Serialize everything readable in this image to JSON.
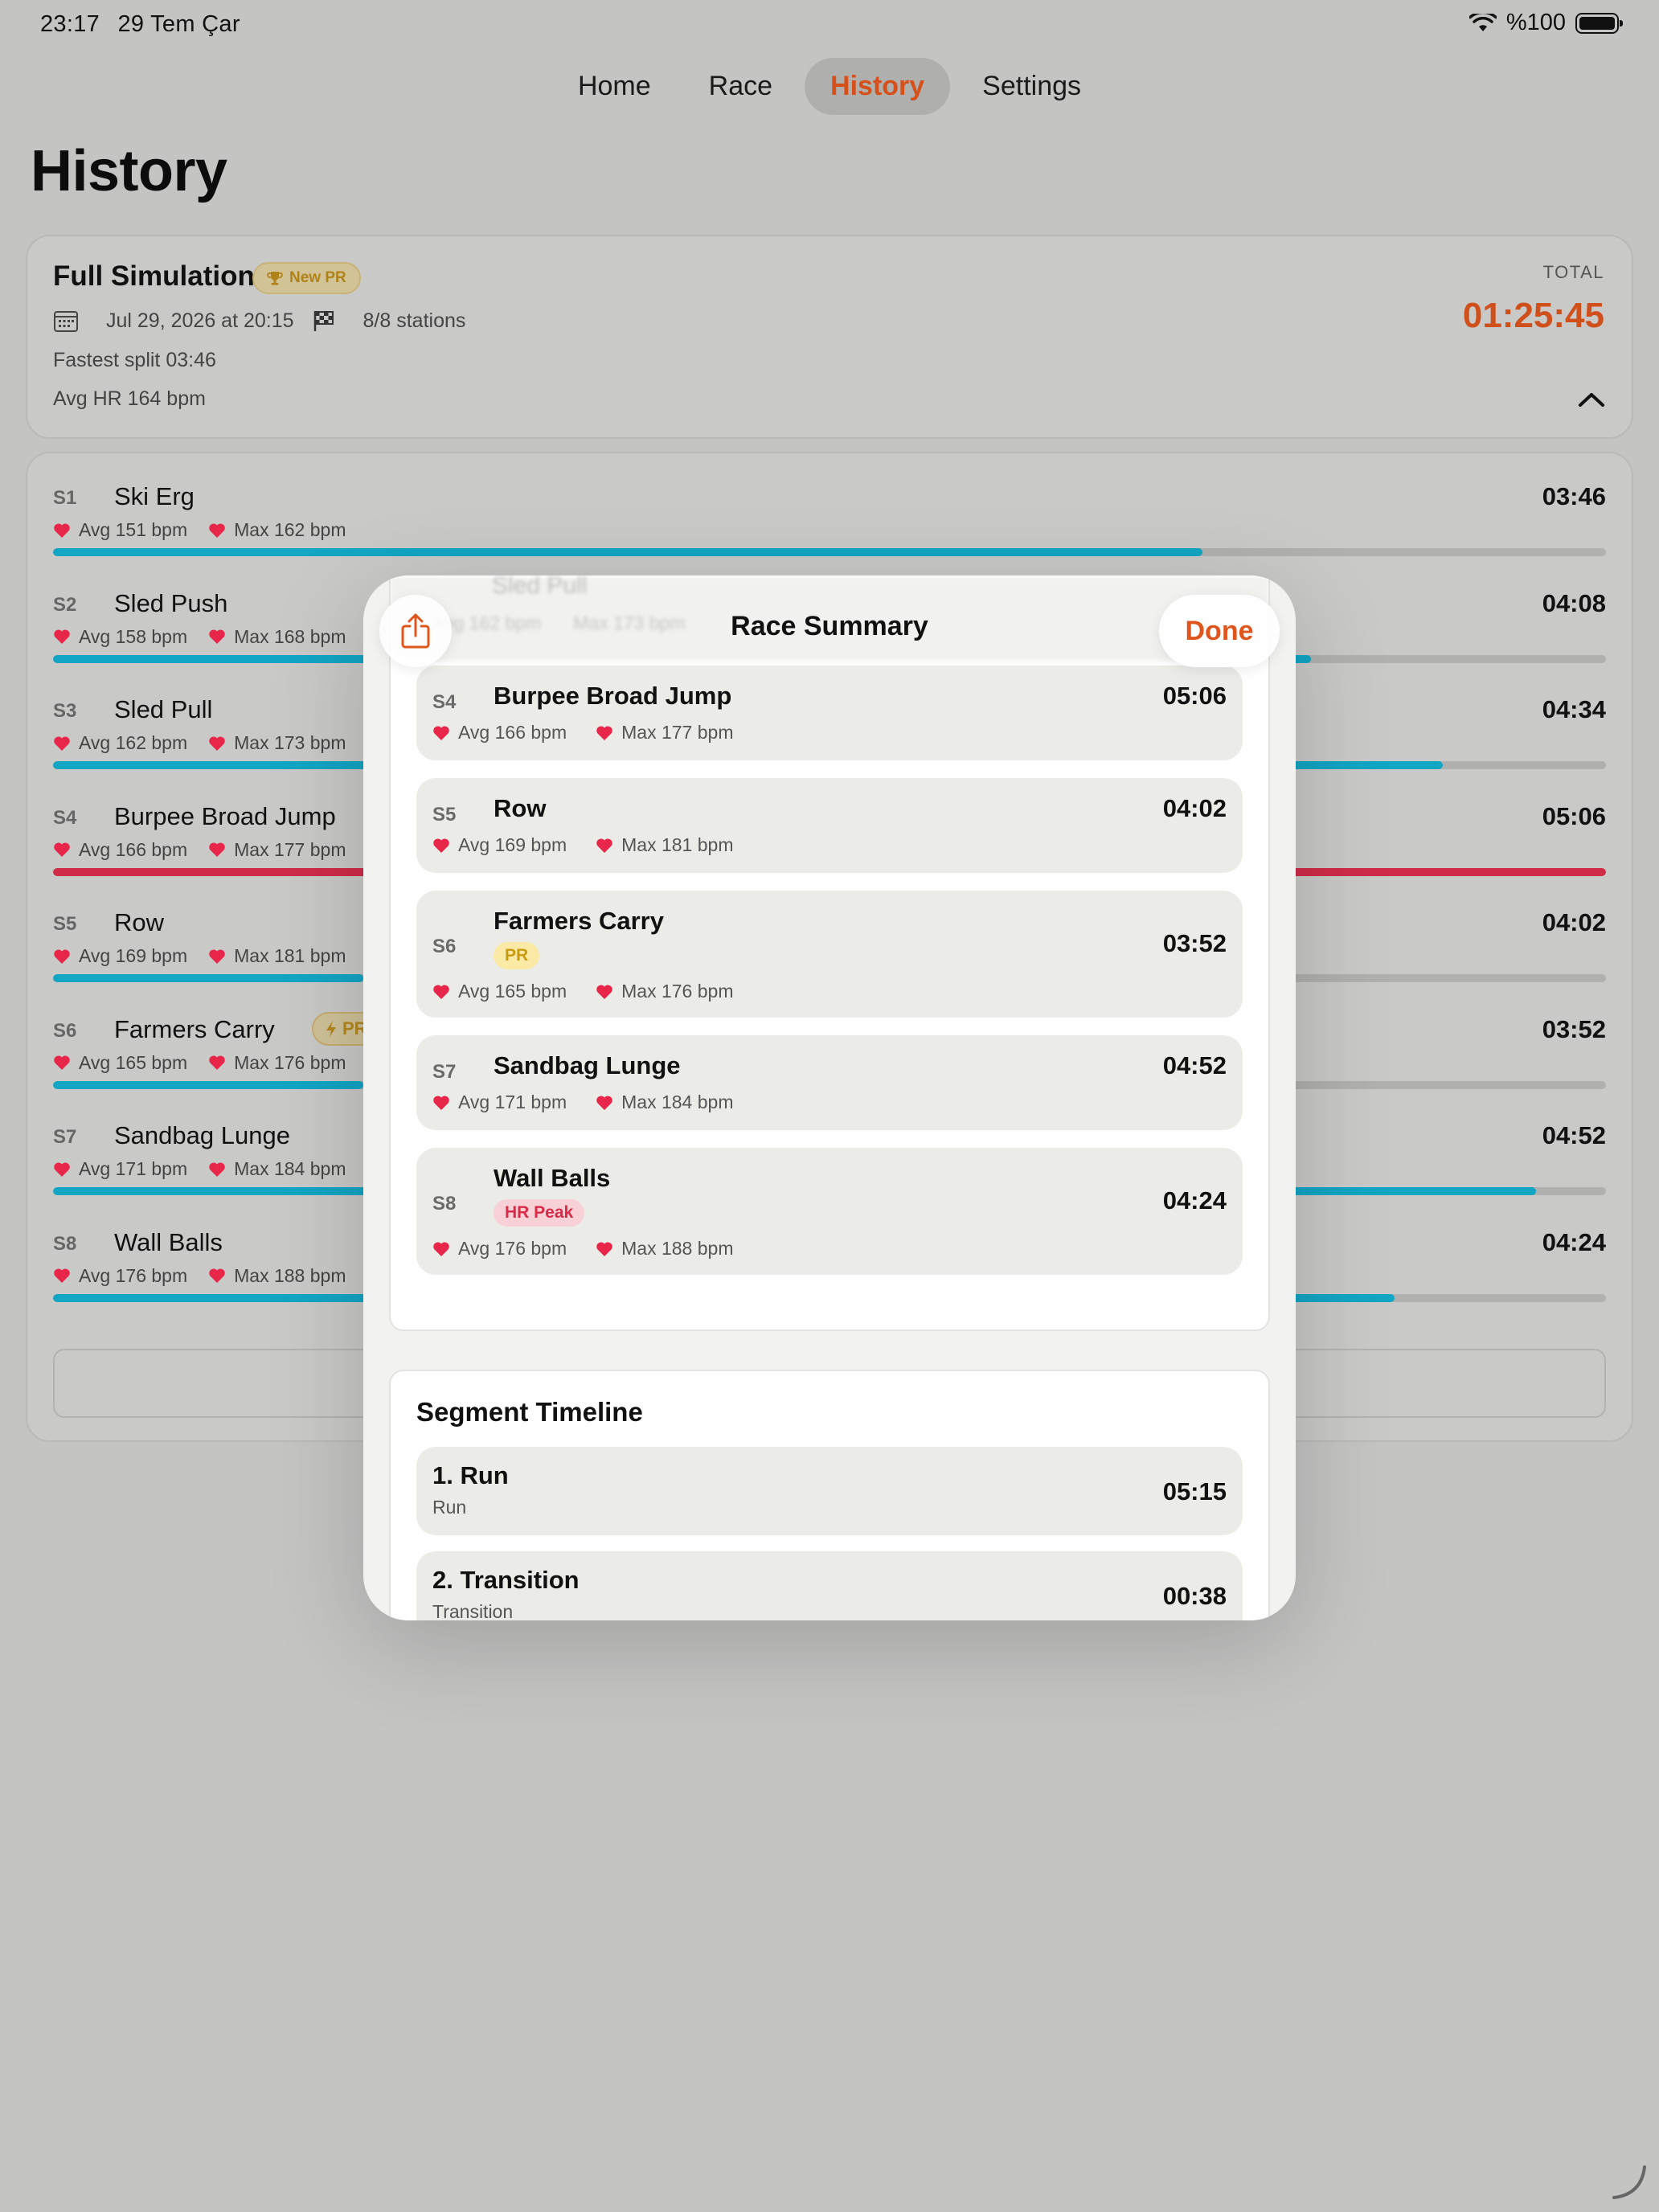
{
  "status_bar": {
    "time": "23:17",
    "date": "29 Tem Çar",
    "battery": "%100"
  },
  "nav": {
    "tabs": [
      "Home",
      "Race",
      "History",
      "Settings"
    ],
    "active": "History"
  },
  "page_title": "History",
  "session": {
    "title": "Full Simulation",
    "pr_badge": "New PR",
    "date": "Jul 29, 2026 at 20:15",
    "stations": "8/8 stations",
    "fastest_split": "Fastest split 03:46",
    "avg_hr": "Avg HR 164 bpm",
    "total_label": "TOTAL",
    "total_time": "01:25:45"
  },
  "splits": [
    {
      "code": "S1",
      "name": "Ski Erg",
      "avg": "Avg 151 bpm",
      "max": "Max 162 bpm",
      "time": "03:46",
      "progress": 0.74,
      "color": "#12a5c4"
    },
    {
      "code": "S2",
      "name": "Sled Push",
      "avg": "Avg 158 bpm",
      "max": "Max 168 bpm",
      "time": "04:08",
      "progress": 0.81,
      "color": "#12a5c4"
    },
    {
      "code": "S3",
      "name": "Sled Pull",
      "avg": "Avg 162 bpm",
      "max": "Max 173 bpm",
      "time": "04:34",
      "progress": 0.895,
      "color": "#12a5c4"
    },
    {
      "code": "S4",
      "name": "Burpee Broad Jump",
      "avg": "Avg 166 bpm",
      "max": "Max 177 bpm",
      "time": "05:06",
      "progress": 1.0,
      "color": "#cf2c48"
    },
    {
      "code": "S5",
      "name": "Row",
      "avg": "Avg 169 bpm",
      "max": "Max 181 bpm",
      "time": "04:02",
      "progress": 0.2,
      "color": "#12a5c4"
    },
    {
      "code": "S6",
      "name": "Farmers Carry",
      "avg": "Avg 165 bpm",
      "max": "Max 176 bpm",
      "time": "03:52",
      "progress": 0.2,
      "color": "#12a5c4",
      "badge": "PR"
    },
    {
      "code": "S7",
      "name": "Sandbag Lunge",
      "avg": "Avg 171 bpm",
      "max": "Max 184 bpm",
      "time": "04:52",
      "progress": 0.955,
      "color": "#12a5c4"
    },
    {
      "code": "S8",
      "name": "Wall Balls",
      "avg": "Avg 176 bpm",
      "max": "Max 188 bpm",
      "time": "04:24",
      "progress": 0.864,
      "color": "#12a5c4"
    }
  ],
  "modal": {
    "title": "Race Summary",
    "done_label": "Done",
    "rows": [
      {
        "code": "S4",
        "name": "Burpee Broad Jump",
        "avg": "Avg 166 bpm",
        "max": "Max 177 bpm",
        "time": "05:06"
      },
      {
        "code": "S5",
        "name": "Row",
        "avg": "Avg 169 bpm",
        "max": "Max 181 bpm",
        "time": "04:02"
      },
      {
        "code": "S6",
        "name": "Farmers Carry",
        "badge": "PR",
        "avg": "Avg 165 bpm",
        "max": "Max 176 bpm",
        "time": "03:52"
      },
      {
        "code": "S7",
        "name": "Sandbag Lunge",
        "avg": "Avg 171 bpm",
        "max": "Max 184 bpm",
        "time": "04:52"
      },
      {
        "code": "S8",
        "name": "Wall Balls",
        "badge": "HR Peak",
        "avg": "Avg 176 bpm",
        "max": "Max 188 bpm",
        "time": "04:24"
      }
    ],
    "timeline_title": "Segment Timeline",
    "timeline": [
      {
        "name": "1. Run",
        "type": "Run",
        "time": "05:15"
      },
      {
        "name": "2. Transition",
        "type": "Transition",
        "time": "00:38"
      }
    ]
  },
  "colors": {
    "accent": "#e0551b",
    "heart": "#e8264a",
    "progress": "#12a5c4",
    "progress_slowest": "#cf2c48"
  }
}
